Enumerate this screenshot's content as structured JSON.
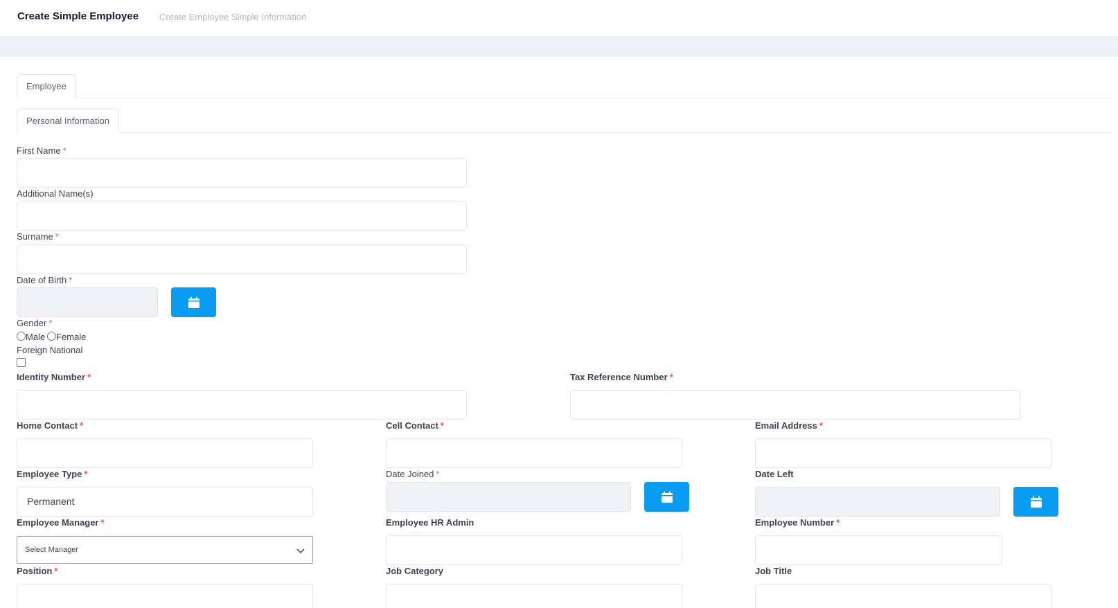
{
  "header": {
    "title": "Create Simple Employee",
    "subtitle": "Create Employee Simple Information"
  },
  "tabs": {
    "employee": "Employee",
    "personal": "Personal Information"
  },
  "form": {
    "first_name": "First Name",
    "additional_names": "Additional Name(s)",
    "surname": "Surname",
    "date_of_birth": "Date of Birth",
    "gender": "Gender",
    "gender_male": "Male",
    "gender_female": "Female",
    "foreign_national": "Foreign National",
    "identity_number": "Identity Number",
    "tax_reference_number": "Tax Reference Number",
    "home_contact": "Home Contact",
    "cell_contact": "Cell Contact",
    "email_address": "Email Address",
    "employee_type": "Employee Type",
    "employee_type_value": "Permanent",
    "date_joined": "Date Joined",
    "date_left": "Date Left",
    "employee_manager": "Employee Manager",
    "employee_manager_value": "Select Manager",
    "employee_hr_admin": "Employee HR Admin",
    "employee_number": "Employee Number",
    "position": "Position",
    "job_category": "Job Category",
    "job_title": "Job Title",
    "required_mark": "*"
  },
  "colors": {
    "accent": "#0a9cf0",
    "required": "#f64e60"
  },
  "icons": {
    "calendar": "calendar-icon",
    "chevron": "chevron-down-icon"
  }
}
